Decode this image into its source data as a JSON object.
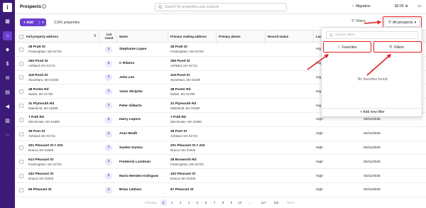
{
  "sidebar": {
    "logo": "i",
    "items": [
      "grid-icon",
      "home-icon",
      "users-icon",
      "dollar-icon",
      "inbox-icon",
      "folder-icon",
      "megaphone-icon",
      "chart-icon",
      "more-icon"
    ]
  },
  "header": {
    "title": "Prospects",
    "search_placeholder": "Search for properties and contacts",
    "migration_label": "Migration",
    "credits": "$0.00",
    "avatar": "I"
  },
  "toolbar": {
    "add_label": "+ Add",
    "count_label": "2,941 properties",
    "filter_label": "Filters",
    "view_label": "All prospects"
  },
  "table": {
    "columns": {
      "address": "Full property address",
      "list_count": "List count",
      "name": "Name",
      "mailing": "Primary mailing address",
      "phone": "Primary phone",
      "record": "Record status",
      "last": "Las"
    },
    "rows": [
      {
        "addr1": "28 Pratt St",
        "addr2": "Framingham, MA 01702",
        "count": "1",
        "name": "Stephanie Lopes",
        "mail1": "28 Pratt St",
        "mail2": "Framingham, MA 01702",
        "status": "High",
        "date": ""
      },
      {
        "addr1": "255 Pond St",
        "addr2": "Ashland, MA 01721",
        "count": "1",
        "name": "C Ribeiro",
        "mail1": "255 Pond St",
        "mail2": "Ashland, MA 01721",
        "status": "High",
        "date": ""
      },
      {
        "addr1": "118 Pond St",
        "addr2": "Stoneham, MA 02180",
        "count": "1",
        "name": "John Lee",
        "mail1": "118 Pond St",
        "mail2": "Stoneham, MA 02180",
        "status": "High",
        "date": ""
      },
      {
        "addr1": "48 Porter Rd",
        "addr2": "Natick, MA 01760",
        "count": "1",
        "name": "Yanis Skripitis",
        "mail1": "48 Porter Rd",
        "mail2": "Natick, MA 01760",
        "status": "High",
        "date": ""
      },
      {
        "addr1": "31 Plymouth Rd",
        "addr2": "Wakefield, MA 01880",
        "count": "1",
        "name": "Peter Gilberto",
        "mail1": "31 Plymouth Rd",
        "mail2": "Wakefield, MA 01880",
        "status": "High",
        "date": ""
      },
      {
        "addr1": "7 Polk Rd",
        "addr2": "Winchester, MA 01890",
        "count": "1",
        "name": "Harry Lepore",
        "mail1": "7 Polk Rd",
        "mail2": "Winchester, MA 01890",
        "status": "High",
        "date": "03/11/2025"
      },
      {
        "addr1": "35 Post St",
        "addr2": "Ashland, MA 01721",
        "count": "1",
        "name": "Arun Modh",
        "mail1": "35 Post St",
        "mail2": "Ashland, MA 01721",
        "status": "High",
        "date": "03/11/2025"
      },
      {
        "addr1": "201 Pleasant St # 203",
        "addr2": "Dracut, MA 01826",
        "count": "1",
        "name": "Suelen Santos",
        "mail1": "201 Pleasant St # 203",
        "mail2": "Dracut, MA 01826",
        "status": "High",
        "date": "03/11/2025"
      },
      {
        "addr1": "613 Pleasant St",
        "addr2": "Framingham, MA 01701",
        "count": "1",
        "name": "Frederick Lavitman",
        "mail1": "28 Bosworth Rd",
        "mail2": "Framingham, MA 01702",
        "status": "High",
        "date": "03/11/2025"
      },
      {
        "addr1": "432 Pleasant St",
        "addr2": "Dracut, MA 01826",
        "count": "1",
        "name": "Mario Mendez-rodriguez",
        "mail1": "432 Pleasant St",
        "mail2": "Dracut, MA 01826",
        "status": "High",
        "date": "03/11/2025"
      },
      {
        "addr1": "65 Pleasant St",
        "addr2": "",
        "count": "1",
        "name": "Brian Leblanc",
        "mail1": "67 Pleasant St",
        "mail2": "",
        "status": "High",
        "date": "03/11/2025"
      }
    ]
  },
  "pagination": {
    "prev": "‹ Previous",
    "pages": [
      "1",
      "2",
      "3",
      "4",
      "5",
      "6",
      "7",
      "8",
      "9",
      "10",
      "...",
      "117",
      "118"
    ],
    "next": "Next ›",
    "active": "1"
  },
  "dropdown": {
    "search_placeholder": "Search filters",
    "tab_favorites": "Favorites",
    "tab_filters": "Filters",
    "empty_text": "No favorites found",
    "add_filter": "+ Add new filter"
  },
  "colors": {
    "brand": "#3d1a78",
    "accent": "#6b3fd1",
    "highlight": "#e02020"
  }
}
